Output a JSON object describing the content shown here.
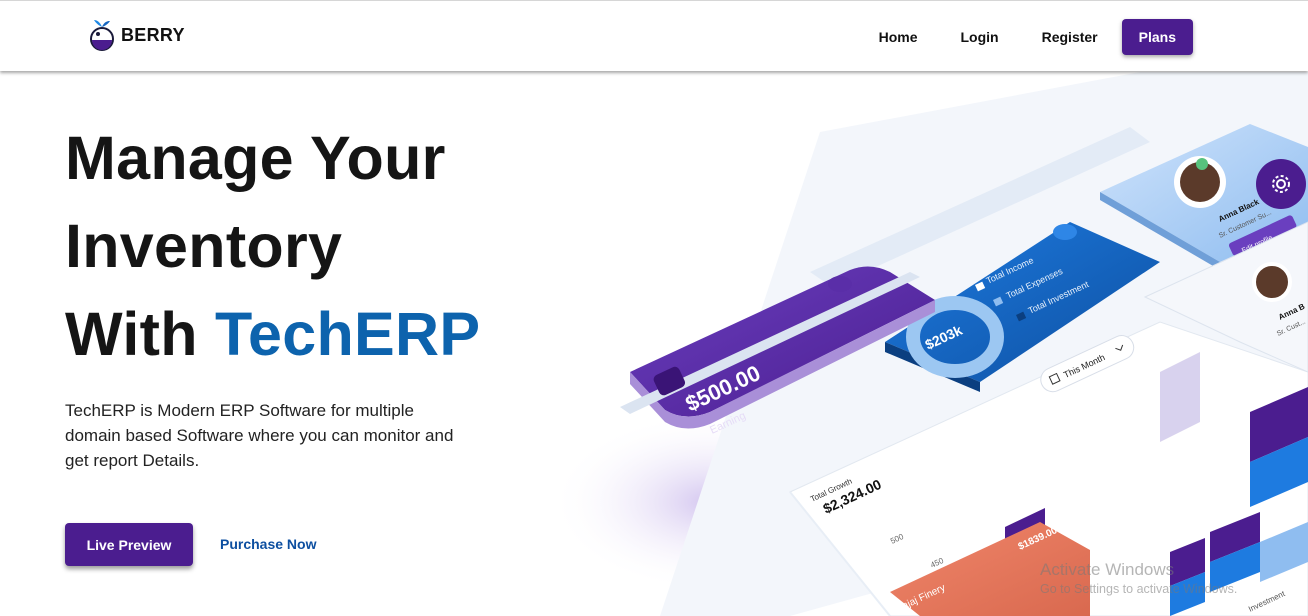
{
  "brand": {
    "name": "BERRY",
    "accent": "#4b1d8f",
    "highlight": "#0d63ad"
  },
  "nav": {
    "home": "Home",
    "login": "Login",
    "register": "Register",
    "plans": "Plans"
  },
  "hero": {
    "line1": "Manage Your",
    "line2": "Inventory",
    "line3_prefix": "With ",
    "line3_accent": "TechERP",
    "description": "TechERP is Modern ERP Software for multiple domain based Software where you can monitor and get report Details."
  },
  "actions": {
    "live_preview": "Live Preview",
    "purchase_now": "Purchase Now"
  },
  "dashboard": {
    "earning_value": "$500.00",
    "earning_label": "Earning",
    "donut_value": "$203k",
    "legend": [
      "Total Income",
      "Total Expenses",
      "Total Investment"
    ],
    "period": "This Month",
    "growth_label": "Total Growth",
    "growth_value": "$2,324.00",
    "axis_ticks": [
      "500",
      "450"
    ],
    "orange_value": "$1839.00",
    "orange_label": "Bajaj Finery",
    "profile_name": "Anna Black",
    "profile_role": "Sr. Customer Su...",
    "profile_button": "Edit profile",
    "profile2_name": "Anna B",
    "profile2_role": "Sr. Cust...",
    "investment_label": "Investment"
  },
  "os_watermark": {
    "line1": "Activate Windows",
    "line2": "Go to Settings to activate Windows."
  },
  "icons": {
    "logo": "berry-logo-icon",
    "settings": "gear-icon",
    "wallet": "wallet-icon",
    "calendar": "calendar-icon"
  }
}
